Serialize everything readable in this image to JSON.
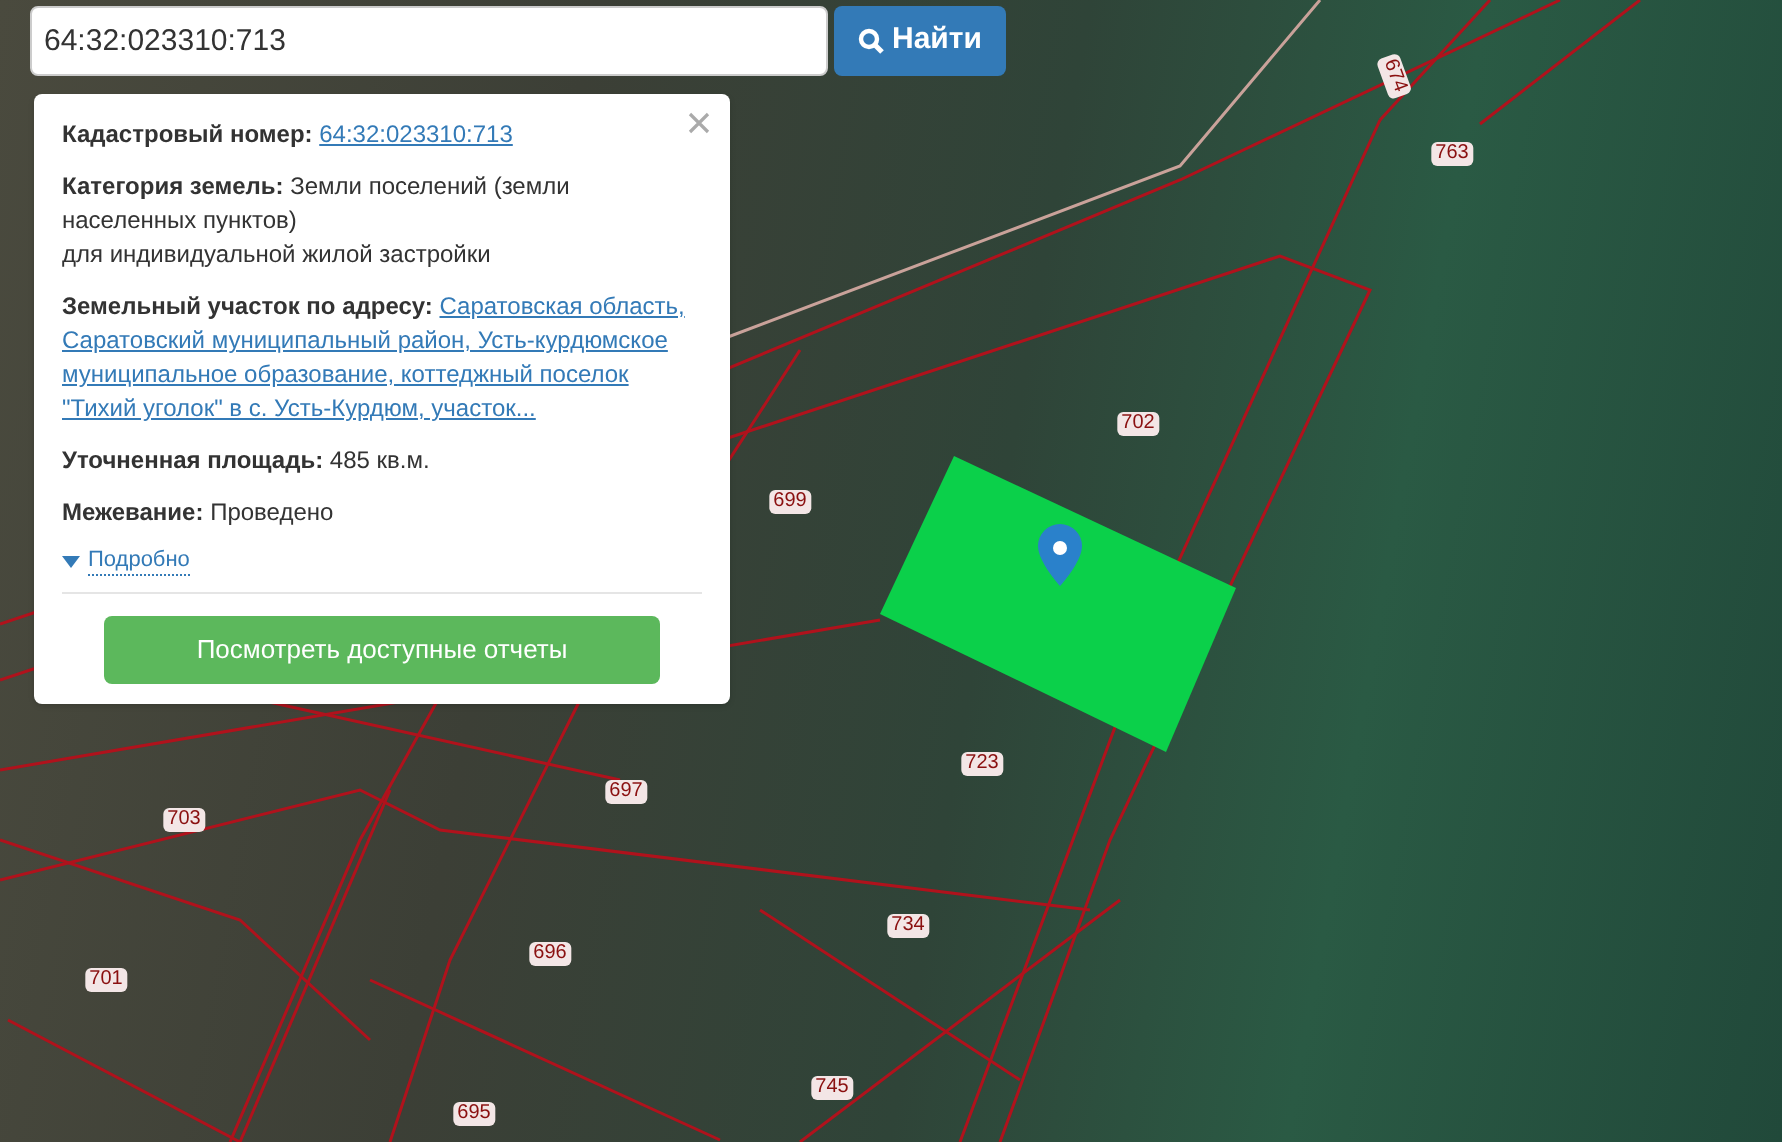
{
  "search": {
    "value": "64:32:023310:713",
    "button": "Найти"
  },
  "popup": {
    "fields": [
      {
        "kind": "link",
        "label": "Кадастровый номер:",
        "lines": [
          "64:32:023310:713"
        ]
      },
      {
        "kind": "text",
        "label": "Категория земель:",
        "lines": [
          "Земли поселений (земли населенных пунктов)",
          "для индивидуальной жилой застройки"
        ]
      },
      {
        "kind": "link",
        "label": "Земельный участок по адресу:",
        "lines": [
          "Саратовская область, Саратовский муниципальный район, Усть-курдюмское муниципальное образование, коттеджный поселок \"Тихий уголок\" в с. Усть-Курдюм, участок..."
        ]
      },
      {
        "kind": "text",
        "label": "Уточненная площадь:",
        "lines": [
          "485 кв.м."
        ]
      },
      {
        "kind": "text",
        "label": "Межевание:",
        "lines": [
          "Проведено"
        ]
      }
    ],
    "details_link": "Подробно",
    "report_button": "Посмотреть доступные отчеты"
  },
  "map": {
    "parcel_labels": [
      "674",
      "763",
      "702",
      "699",
      "723",
      "697",
      "703",
      "734",
      "696",
      "701",
      "745",
      "695"
    ]
  }
}
